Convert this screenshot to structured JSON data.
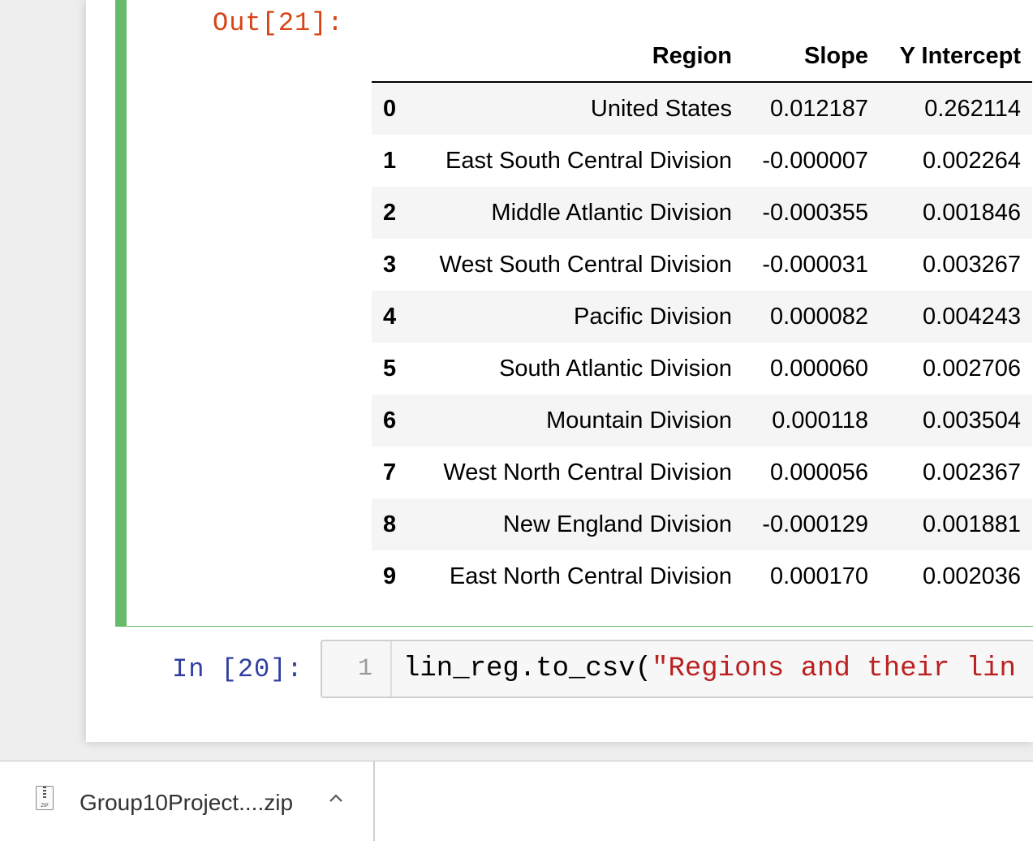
{
  "output_cell": {
    "prompt": "Out[21]:",
    "table": {
      "columns": [
        "Region",
        "Slope",
        "Y Intercept"
      ],
      "rows": [
        {
          "index": "0",
          "region": "United States",
          "slope": "0.012187",
          "y_intercept": "0.262114"
        },
        {
          "index": "1",
          "region": "East South Central Division",
          "slope": "-0.000007",
          "y_intercept": "0.002264"
        },
        {
          "index": "2",
          "region": "Middle Atlantic Division",
          "slope": "-0.000355",
          "y_intercept": "0.001846"
        },
        {
          "index": "3",
          "region": "West South Central Division",
          "slope": "-0.000031",
          "y_intercept": "0.003267"
        },
        {
          "index": "4",
          "region": "Pacific Division",
          "slope": "0.000082",
          "y_intercept": "0.004243"
        },
        {
          "index": "5",
          "region": "South Atlantic Division",
          "slope": "0.000060",
          "y_intercept": "0.002706"
        },
        {
          "index": "6",
          "region": "Mountain Division",
          "slope": "0.000118",
          "y_intercept": "0.003504"
        },
        {
          "index": "7",
          "region": "West North Central Division",
          "slope": "0.000056",
          "y_intercept": "0.002367"
        },
        {
          "index": "8",
          "region": "New England Division",
          "slope": "-0.000129",
          "y_intercept": "0.001881"
        },
        {
          "index": "9",
          "region": "East North Central Division",
          "slope": "0.000170",
          "y_intercept": "0.002036"
        }
      ]
    }
  },
  "input_cell": {
    "prompt": "In [20]:",
    "line_number": "1",
    "code_plain": "lin_reg.to_csv(",
    "code_string": "\"Regions and their lin"
  },
  "download_bar": {
    "file_name": "Group10Project....zip",
    "icon_label": "ZIP",
    "icon": "zip-file-icon",
    "chevron": "chevron-up-icon"
  },
  "colors": {
    "active_cell_border": "#66bb6a",
    "out_prompt": "#d84315",
    "in_prompt": "#303f9f",
    "string": "#ba2121"
  }
}
